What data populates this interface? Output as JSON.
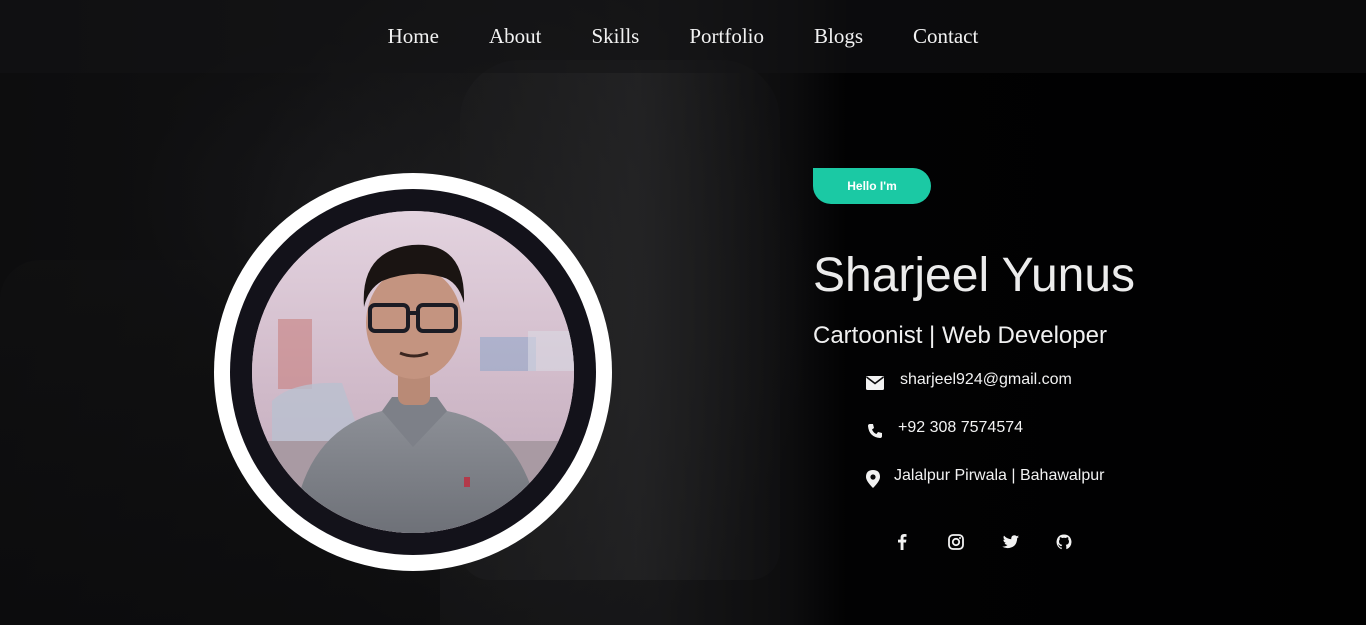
{
  "nav": {
    "items": [
      {
        "label": "Home"
      },
      {
        "label": "About"
      },
      {
        "label": "Skills"
      },
      {
        "label": "Portfolio"
      },
      {
        "label": "Blogs"
      },
      {
        "label": "Contact"
      }
    ]
  },
  "hero": {
    "badge": "Hello I'm",
    "name": "Sharjeel Yunus",
    "tagline": "Cartoonist | Web Developer",
    "contacts": [
      {
        "icon": "envelope-icon",
        "text": "sharjeel924@gmail.com"
      },
      {
        "icon": "phone-icon",
        "text": "+92 308 7574574"
      },
      {
        "icon": "map-pin-icon",
        "text": "Jalalpur Pirwala | Bahawalpur"
      }
    ],
    "socials": [
      {
        "icon": "facebook-icon"
      },
      {
        "icon": "instagram-icon"
      },
      {
        "icon": "twitter-icon"
      },
      {
        "icon": "github-icon"
      }
    ]
  },
  "colors": {
    "accent": "#1bc9a4",
    "ring": "#ffffff",
    "ring_inner": "#13121a",
    "text": "#f0f0f0"
  }
}
